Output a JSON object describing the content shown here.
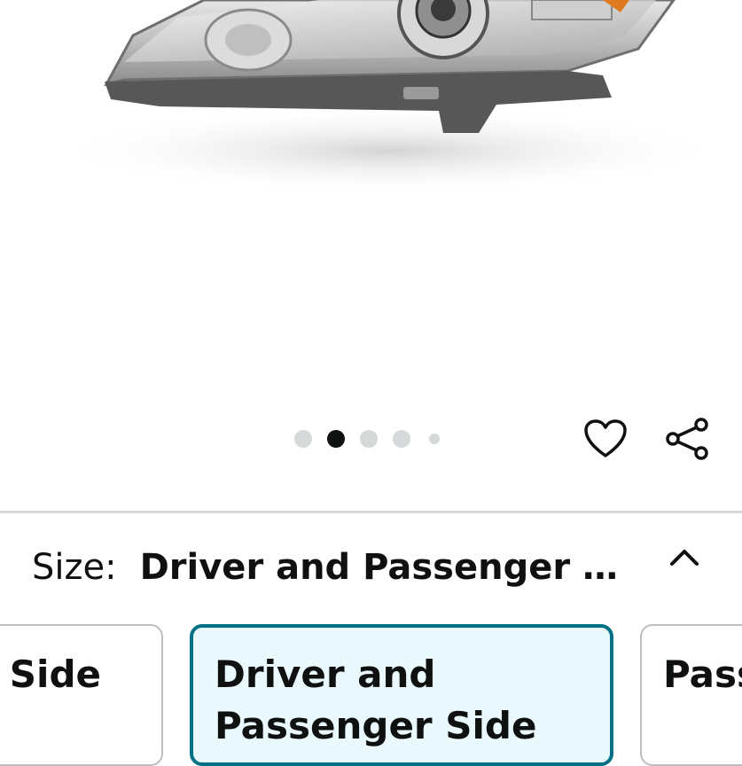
{
  "product": {
    "image_alt": "headlight-product-image"
  },
  "carousel": {
    "dot_count": 5,
    "active_index": 1
  },
  "actions": {
    "favorite_icon": "heart-icon",
    "share_icon": "share-icon"
  },
  "size_selector": {
    "label": "Size:",
    "selected_value": "Driver and Passenger …",
    "collapse_icon": "chevron-up-icon",
    "options": [
      {
        "label": "r Side",
        "selected": false
      },
      {
        "label": "Driver and Passenger Side",
        "selected": true
      },
      {
        "label": "Pass",
        "selected": false
      }
    ]
  },
  "colors": {
    "selected_border": "#007185",
    "selected_bg": "#e9f9fd",
    "dot_inactive": "#d5d9d9",
    "dot_active": "#0f1111"
  }
}
